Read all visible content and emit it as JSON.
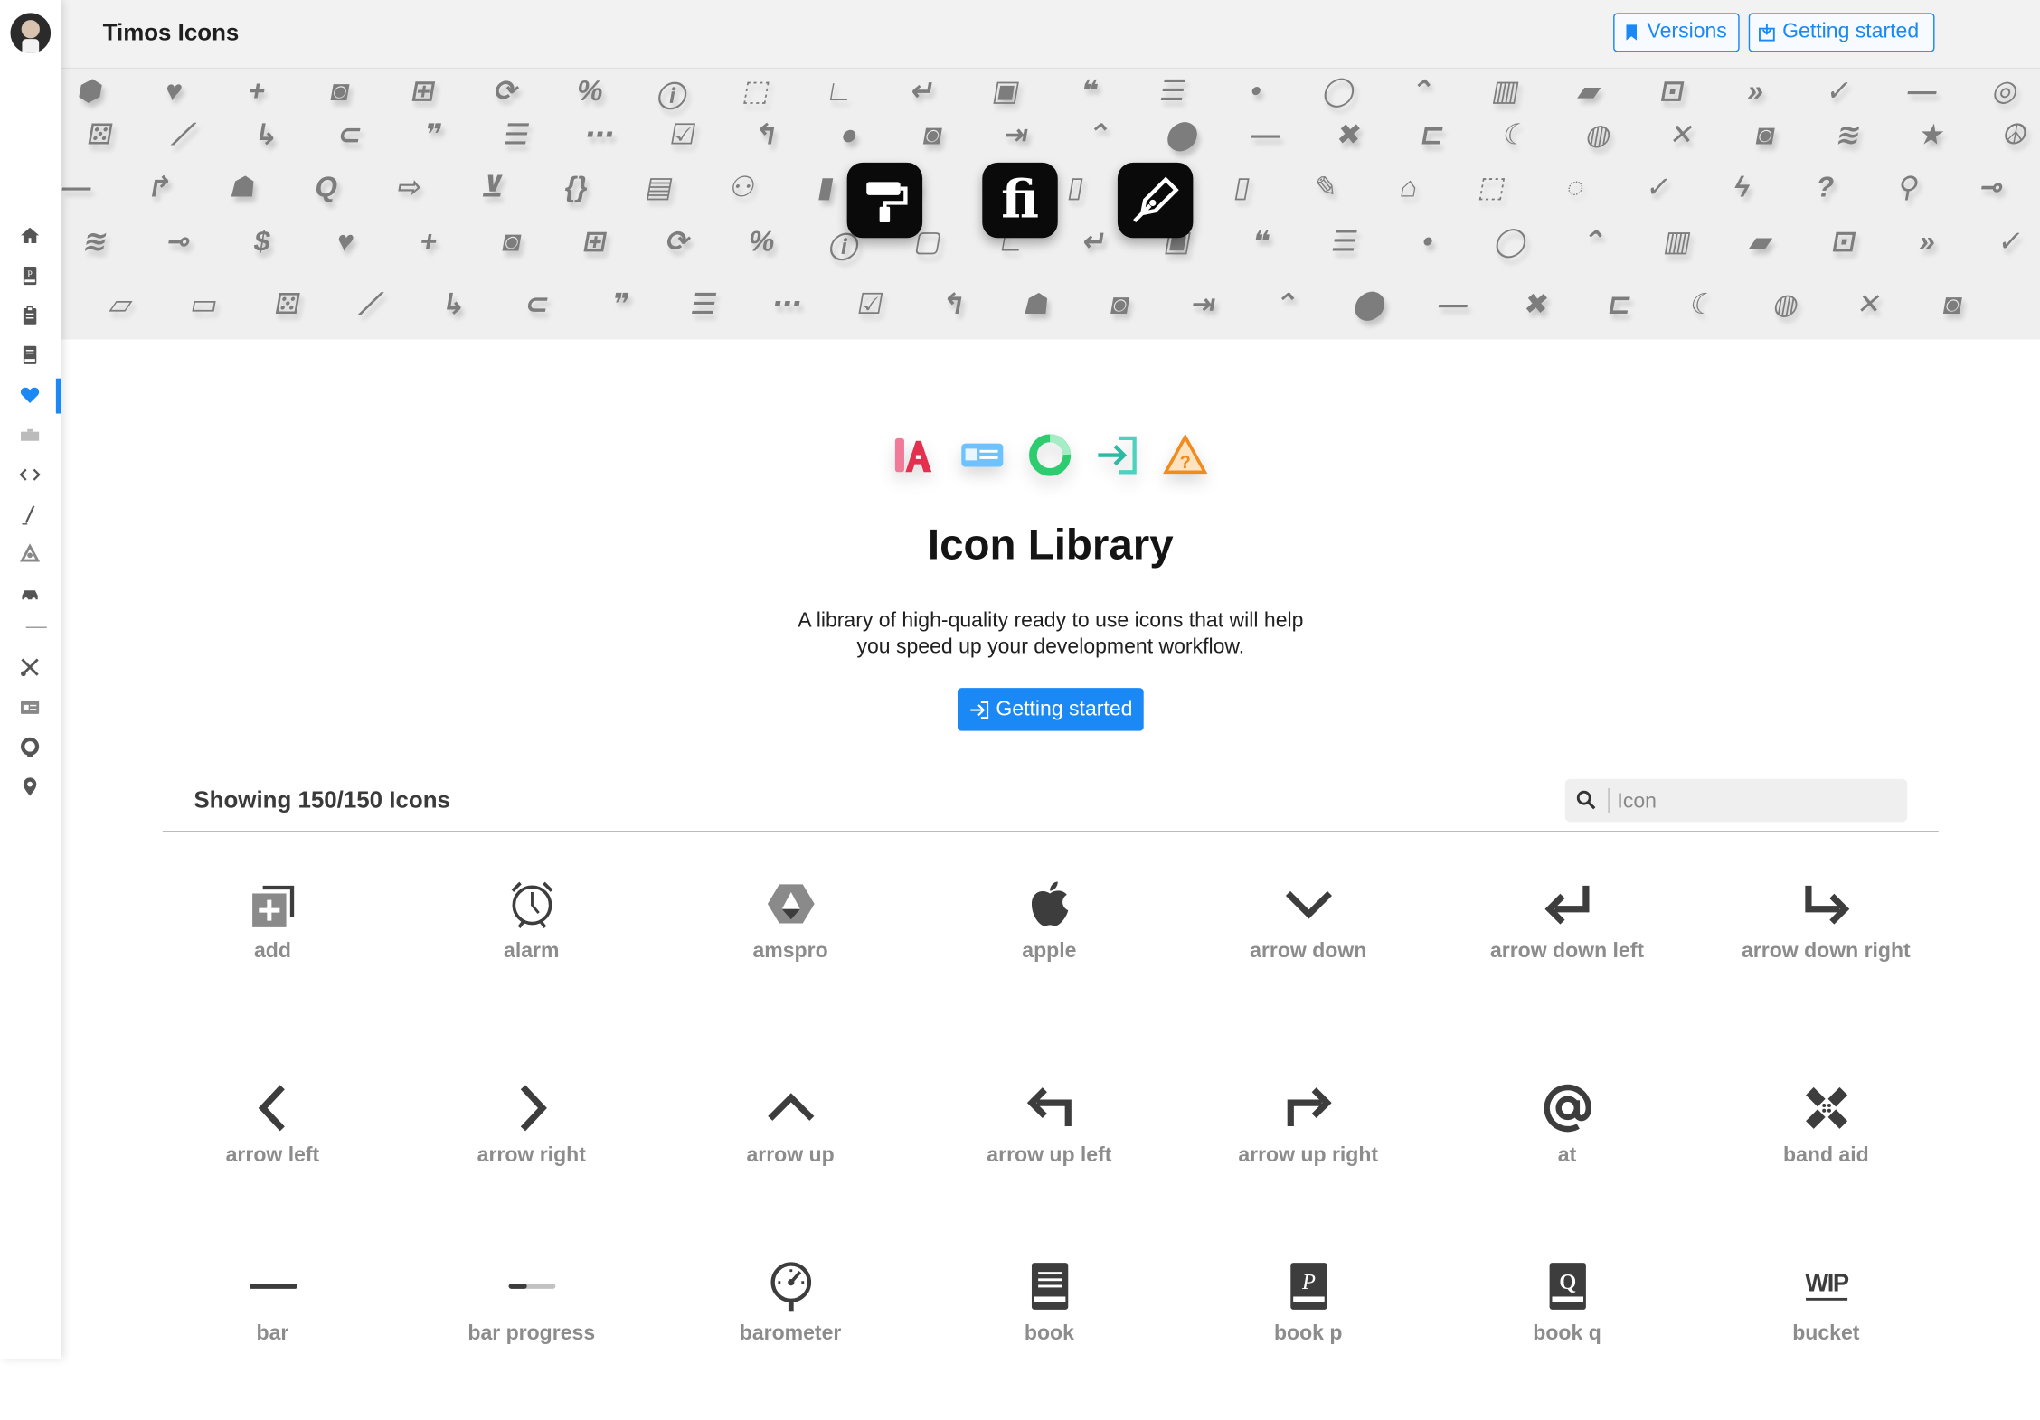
{
  "app": {
    "title": "Timos Icons",
    "accent_color": "#1a88f5"
  },
  "header": {
    "versions_label": "Versions",
    "getting_started_label": "Getting started"
  },
  "sidebar": {
    "items": [
      {
        "icon": "home-icon"
      },
      {
        "icon": "book-p-icon"
      },
      {
        "icon": "clipboard-icon"
      },
      {
        "icon": "book-icon"
      },
      {
        "icon": "heart-icon",
        "active": true
      },
      {
        "icon": "toggle-icon"
      },
      {
        "icon": "code-icon"
      },
      {
        "icon": "pen-icon"
      },
      {
        "icon": "recycle-icon"
      },
      {
        "icon": "car-icon"
      },
      {
        "icon": "tools-icon"
      },
      {
        "icon": "id-card-icon"
      },
      {
        "icon": "github-icon"
      },
      {
        "icon": "location-pin-icon"
      }
    ]
  },
  "banner": {
    "tiles": [
      "paint-roller-app-icon",
      "fi-ligature-app-icon",
      "fountain-pen-app-icon"
    ],
    "tile_fi_text": "fi"
  },
  "hero": {
    "title": "Icon Library",
    "description_line1": "A library of high-quality ready to use icons that will help",
    "description_line2": "you speed up your development workflow.",
    "button_label": "Getting started"
  },
  "toolbar": {
    "count_text": "Showing 150/150 Icons",
    "search_placeholder": "Icon",
    "search_value": ""
  },
  "icons": [
    {
      "label": "add",
      "icon": "add-icon"
    },
    {
      "label": "alarm",
      "icon": "alarm-icon"
    },
    {
      "label": "amspro",
      "icon": "amspro-icon"
    },
    {
      "label": "apple",
      "icon": "apple-icon"
    },
    {
      "label": "arrow down",
      "icon": "arrow-down-icon"
    },
    {
      "label": "arrow down left",
      "icon": "arrow-down-left-icon"
    },
    {
      "label": "arrow down right",
      "icon": "arrow-down-right-icon"
    },
    {
      "label": "arrow left",
      "icon": "arrow-left-icon"
    },
    {
      "label": "arrow right",
      "icon": "arrow-right-icon"
    },
    {
      "label": "arrow up",
      "icon": "arrow-up-icon"
    },
    {
      "label": "arrow up left",
      "icon": "arrow-up-left-icon"
    },
    {
      "label": "arrow up right",
      "icon": "arrow-up-right-icon"
    },
    {
      "label": "at",
      "icon": "at-icon"
    },
    {
      "label": "band aid",
      "icon": "band-aid-icon"
    },
    {
      "label": "bar",
      "icon": "bar-icon"
    },
    {
      "label": "bar progress",
      "icon": "bar-progress-icon"
    },
    {
      "label": "barometer",
      "icon": "barometer-icon"
    },
    {
      "label": "book",
      "icon": "book-icon"
    },
    {
      "label": "book p",
      "icon": "book-p-icon"
    },
    {
      "label": "book q",
      "icon": "book-q-icon"
    },
    {
      "label": "bucket",
      "icon": "bucket-icon",
      "glyph": "WIP"
    }
  ]
}
